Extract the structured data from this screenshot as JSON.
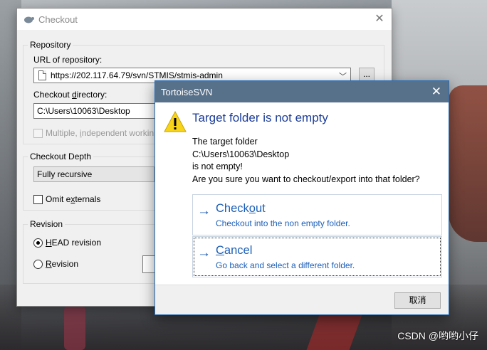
{
  "checkout": {
    "title": "Checkout",
    "repository_group": "Repository",
    "url_label_pre": "URL of repository:",
    "url_value": "https://202.117.64.79/svn/STMIS/stmis-admin",
    "browse_button": "...",
    "dir_label_pre": "Checkout ",
    "dir_label_u": "d",
    "dir_label_post": "irectory:",
    "dir_value": "C:\\Users\\10063\\Desktop",
    "multiple_pre": "Multiple, ",
    "multiple_u": "i",
    "multiple_post": "ndependent workin",
    "depth_group": "Checkout Depth",
    "depth_value": "Fully recursive",
    "omit_pre": "Omit e",
    "omit_u": "x",
    "omit_post": "ternals",
    "revision_group": "Revision",
    "head_u": "H",
    "head_post": "EAD revision",
    "rev_u": "R",
    "rev_post": "evision"
  },
  "dialog": {
    "title": "TortoiseSVN",
    "heading": "Target folder is not empty",
    "body_line1": "The target folder",
    "body_line2": "C:\\Users\\10063\\Desktop",
    "body_line3": "is not empty!",
    "body_line4": "Are you sure you want to checkout/export into that folder?",
    "option1_title_pre": "Check",
    "option1_title_u": "o",
    "option1_title_post": "ut",
    "option1_sub": "Checkout into the non empty folder.",
    "option2_title_u": "C",
    "option2_title_post": "ancel",
    "option2_sub": "Go back and select a different folder.",
    "cancel_button": "取消"
  },
  "watermark": "CSDN @哟哟小仔",
  "colors": {
    "dialog_title_bg": "#58718a",
    "link_blue": "#1c5fb8",
    "heading_blue": "#1c3d99"
  }
}
